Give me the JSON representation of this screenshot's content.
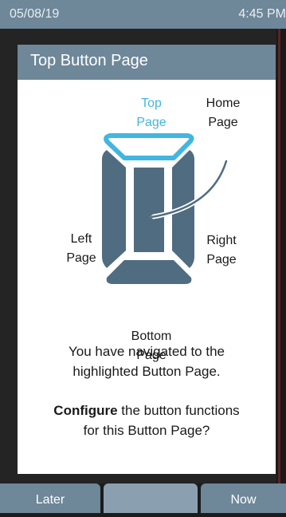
{
  "status_bar": {
    "date": "05/08/19",
    "time": "4:45 PM"
  },
  "dialog": {
    "title": "Top Button Page",
    "diagram": {
      "labels": {
        "top": [
          "Top",
          "Page"
        ],
        "home": [
          "Home",
          "Page"
        ],
        "left": [
          "Left",
          "Page"
        ],
        "right": [
          "Right",
          "Page"
        ],
        "bottom": [
          "Bottom",
          "Page"
        ]
      },
      "highlighted": "top"
    },
    "message_line1": "You have navigated to the",
    "message_line2": "highlighted Button Page.",
    "question_bold": "Configure",
    "question_rest": " the button functions",
    "question_line2": "for this Button Page?"
  },
  "softkeys": {
    "left": "Later",
    "middle": "",
    "right": "Now"
  },
  "colors": {
    "accent": "#42b6e0",
    "panel": "#6e8799",
    "diagram_fill": "#4f6c80"
  }
}
